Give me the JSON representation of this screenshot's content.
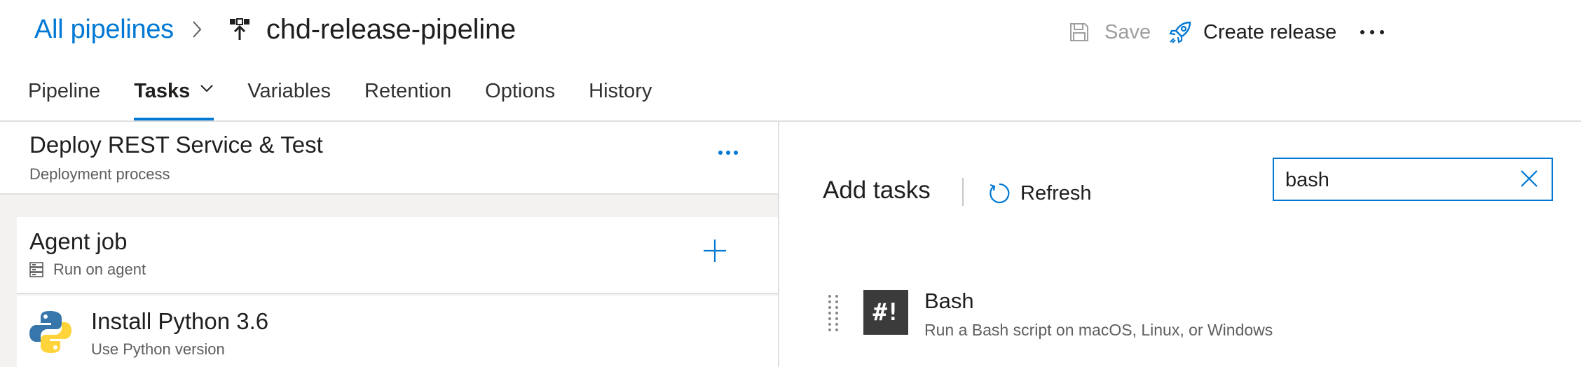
{
  "header": {
    "breadcrumb_link": "All pipelines",
    "pipeline_title": "chd-release-pipeline",
    "save_label": "Save",
    "create_release_label": "Create release"
  },
  "tabs": [
    {
      "label": "Pipeline",
      "active": false
    },
    {
      "label": "Tasks",
      "active": true
    },
    {
      "label": "Variables",
      "active": false
    },
    {
      "label": "Retention",
      "active": false
    },
    {
      "label": "Options",
      "active": false
    },
    {
      "label": "History",
      "active": false
    }
  ],
  "left_pane": {
    "deploy": {
      "title": "Deploy REST Service & Test",
      "subtitle": "Deployment process"
    },
    "agent_job": {
      "title": "Agent job",
      "subtitle": "Run on agent"
    },
    "tasks": [
      {
        "title": "Install Python 3.6",
        "subtitle": "Use Python version"
      }
    ]
  },
  "right_pane": {
    "title": "Add tasks",
    "refresh_label": "Refresh",
    "search": {
      "value": "bash",
      "placeholder": ""
    },
    "results": [
      {
        "title": "Bash",
        "icon_text": "#!",
        "description": "Run a Bash script on macOS, Linux, or Windows"
      }
    ]
  },
  "colors": {
    "accent": "#0078d4",
    "text": "#201f1e",
    "secondary_text": "#605e5c",
    "disabled": "#a19f9d",
    "divider": "#e1dfdd",
    "panel_bg": "#f3f2f1",
    "python_blue": "#3776ab",
    "python_yellow": "#ffd43b"
  },
  "icons": [
    "chevron-right-icon",
    "pipeline-icon",
    "save-icon",
    "rocket-icon",
    "more-icon",
    "chevron-down-icon",
    "server-icon",
    "plus-icon",
    "refresh-icon",
    "clear-icon",
    "drag-handle-icon",
    "bash-icon",
    "python-icon"
  ]
}
